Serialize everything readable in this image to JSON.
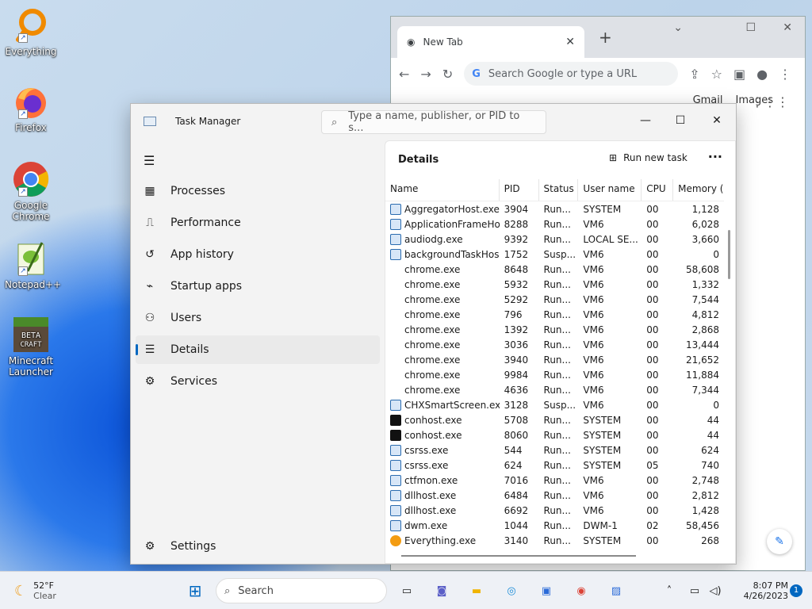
{
  "desktop": {
    "icons": [
      "Everything",
      "Firefox",
      "Google Chrome",
      "Notepad++",
      "Minecraft Launcher"
    ]
  },
  "chrome": {
    "tab_title": "New Tab",
    "search_placeholder": "Search Google or type a URL",
    "links": [
      "Gmail",
      "Images"
    ]
  },
  "taskmgr": {
    "title": "Task Manager",
    "search_placeholder": "Type a name, publisher, or PID to s...",
    "nav": [
      "Processes",
      "Performance",
      "App history",
      "Startup apps",
      "Users",
      "Details",
      "Services"
    ],
    "settings": "Settings",
    "page_title": "Details",
    "run_new_task": "Run new task",
    "columns": [
      "Name",
      "PID",
      "Status",
      "User name",
      "CPU",
      "Memory ("
    ],
    "rows": [
      {
        "icon": "win",
        "name": "AggregatorHost.exe",
        "pid": "3904",
        "status": "Run...",
        "user": "SYSTEM",
        "cpu": "00",
        "mem": "1,128"
      },
      {
        "icon": "win",
        "name": "ApplicationFrameHo...",
        "pid": "8288",
        "status": "Run...",
        "user": "VM6",
        "cpu": "00",
        "mem": "6,028"
      },
      {
        "icon": "win",
        "name": "audiodg.exe",
        "pid": "9392",
        "status": "Run...",
        "user": "LOCAL SE...",
        "cpu": "00",
        "mem": "3,660"
      },
      {
        "icon": "win",
        "name": "backgroundTaskHos...",
        "pid": "1752",
        "status": "Susp...",
        "user": "VM6",
        "cpu": "00",
        "mem": "0"
      },
      {
        "icon": "chrome",
        "name": "chrome.exe",
        "pid": "8648",
        "status": "Run...",
        "user": "VM6",
        "cpu": "00",
        "mem": "58,608"
      },
      {
        "icon": "chrome",
        "name": "chrome.exe",
        "pid": "5932",
        "status": "Run...",
        "user": "VM6",
        "cpu": "00",
        "mem": "1,332"
      },
      {
        "icon": "chrome",
        "name": "chrome.exe",
        "pid": "5292",
        "status": "Run...",
        "user": "VM6",
        "cpu": "00",
        "mem": "7,544"
      },
      {
        "icon": "chrome",
        "name": "chrome.exe",
        "pid": "796",
        "status": "Run...",
        "user": "VM6",
        "cpu": "00",
        "mem": "4,812"
      },
      {
        "icon": "chrome",
        "name": "chrome.exe",
        "pid": "1392",
        "status": "Run...",
        "user": "VM6",
        "cpu": "00",
        "mem": "2,868"
      },
      {
        "icon": "chrome",
        "name": "chrome.exe",
        "pid": "3036",
        "status": "Run...",
        "user": "VM6",
        "cpu": "00",
        "mem": "13,444"
      },
      {
        "icon": "chrome",
        "name": "chrome.exe",
        "pid": "3940",
        "status": "Run...",
        "user": "VM6",
        "cpu": "00",
        "mem": "21,652"
      },
      {
        "icon": "chrome",
        "name": "chrome.exe",
        "pid": "9984",
        "status": "Run...",
        "user": "VM6",
        "cpu": "00",
        "mem": "11,884"
      },
      {
        "icon": "chrome",
        "name": "chrome.exe",
        "pid": "4636",
        "status": "Run...",
        "user": "VM6",
        "cpu": "00",
        "mem": "7,344"
      },
      {
        "icon": "win",
        "name": "CHXSmartScreen.exe",
        "pid": "3128",
        "status": "Susp...",
        "user": "VM6",
        "cpu": "00",
        "mem": "0"
      },
      {
        "icon": "con",
        "name": "conhost.exe",
        "pid": "5708",
        "status": "Run...",
        "user": "SYSTEM",
        "cpu": "00",
        "mem": "44"
      },
      {
        "icon": "con",
        "name": "conhost.exe",
        "pid": "8060",
        "status": "Run...",
        "user": "SYSTEM",
        "cpu": "00",
        "mem": "44"
      },
      {
        "icon": "win",
        "name": "csrss.exe",
        "pid": "544",
        "status": "Run...",
        "user": "SYSTEM",
        "cpu": "00",
        "mem": "624"
      },
      {
        "icon": "win",
        "name": "csrss.exe",
        "pid": "624",
        "status": "Run...",
        "user": "SYSTEM",
        "cpu": "05",
        "mem": "740"
      },
      {
        "icon": "win",
        "name": "ctfmon.exe",
        "pid": "7016",
        "status": "Run...",
        "user": "VM6",
        "cpu": "00",
        "mem": "2,748"
      },
      {
        "icon": "win",
        "name": "dllhost.exe",
        "pid": "6484",
        "status": "Run...",
        "user": "VM6",
        "cpu": "00",
        "mem": "2,812"
      },
      {
        "icon": "win",
        "name": "dllhost.exe",
        "pid": "6692",
        "status": "Run...",
        "user": "VM6",
        "cpu": "00",
        "mem": "1,428"
      },
      {
        "icon": "win",
        "name": "dwm.exe",
        "pid": "1044",
        "status": "Run...",
        "user": "DWM-1",
        "cpu": "02",
        "mem": "58,456"
      },
      {
        "icon": "ev",
        "name": "Everything.exe",
        "pid": "3140",
        "status": "Run...",
        "user": "SYSTEM",
        "cpu": "00",
        "mem": "268"
      }
    ]
  },
  "taskbar": {
    "temp": "52°F",
    "condition": "Clear",
    "search": "Search",
    "time": "8:07 PM",
    "date": "4/26/2023",
    "notifications": "1"
  }
}
